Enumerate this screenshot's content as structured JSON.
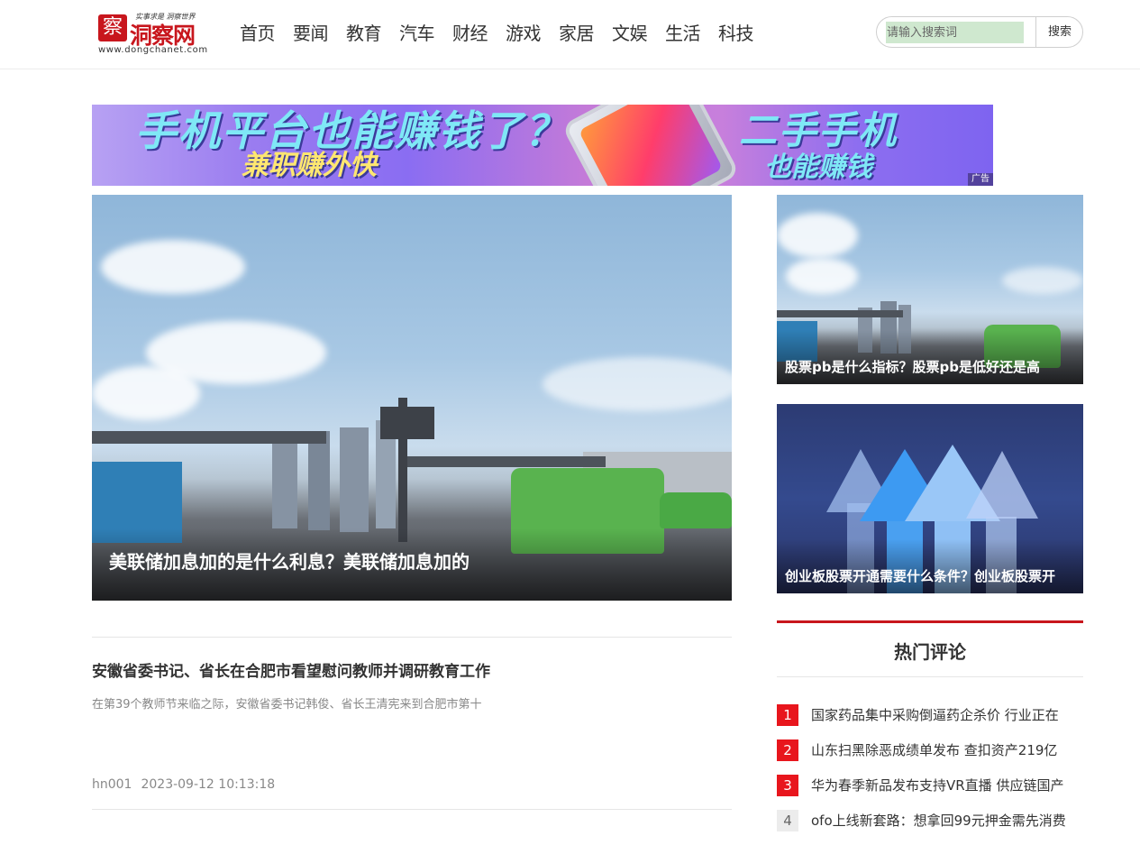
{
  "logo": {
    "seal": "察",
    "name": "洞察网",
    "slogan": "实事求是 洞察世界",
    "url": "www.dongchanet.com"
  },
  "nav": [
    "首页",
    "要闻",
    "教育",
    "汽车",
    "财经",
    "游戏",
    "家居",
    "文娱",
    "生活",
    "科技"
  ],
  "search": {
    "placeholder": "请输入搜索词",
    "button": "搜索"
  },
  "ad": {
    "line1": "手机平台也能赚钱了？",
    "line2": "兼职赚外快",
    "line3": "二手手机",
    "line4": "也能赚钱",
    "tag": "广告"
  },
  "featured": {
    "caption": "美联储加息加的是什么利息？美联储加息加的"
  },
  "side": [
    {
      "caption": "股票pb是什么指标？股票pb是低好还是高"
    },
    {
      "caption": "创业板股票开通需要什么条件？创业板股票开"
    }
  ],
  "article": {
    "title": "安徽省委书记、省长在合肥市看望慰问教师并调研教育工作",
    "summary": "在第39个教师节来临之际，安徽省委书记韩俊、省长王清宪来到合肥市第十",
    "author": "hn001",
    "time": "2023-09-12 10:13:18"
  },
  "hot": {
    "title": "热门评论",
    "items": [
      {
        "num": "1",
        "text": "国家药品集中采购倒逼药企杀价 行业正在"
      },
      {
        "num": "2",
        "text": "山东扫黑除恶成绩单发布 查扣资产219亿"
      },
      {
        "num": "3",
        "text": "华为春季新品发布支持VR直播 供应链国产"
      },
      {
        "num": "4",
        "text": "ofo上线新套路：想拿回99元押金需先消费"
      }
    ]
  },
  "colors": {
    "brand": "#c8161d",
    "rank_top": "#e8161d",
    "rank_other": "#ececec"
  }
}
